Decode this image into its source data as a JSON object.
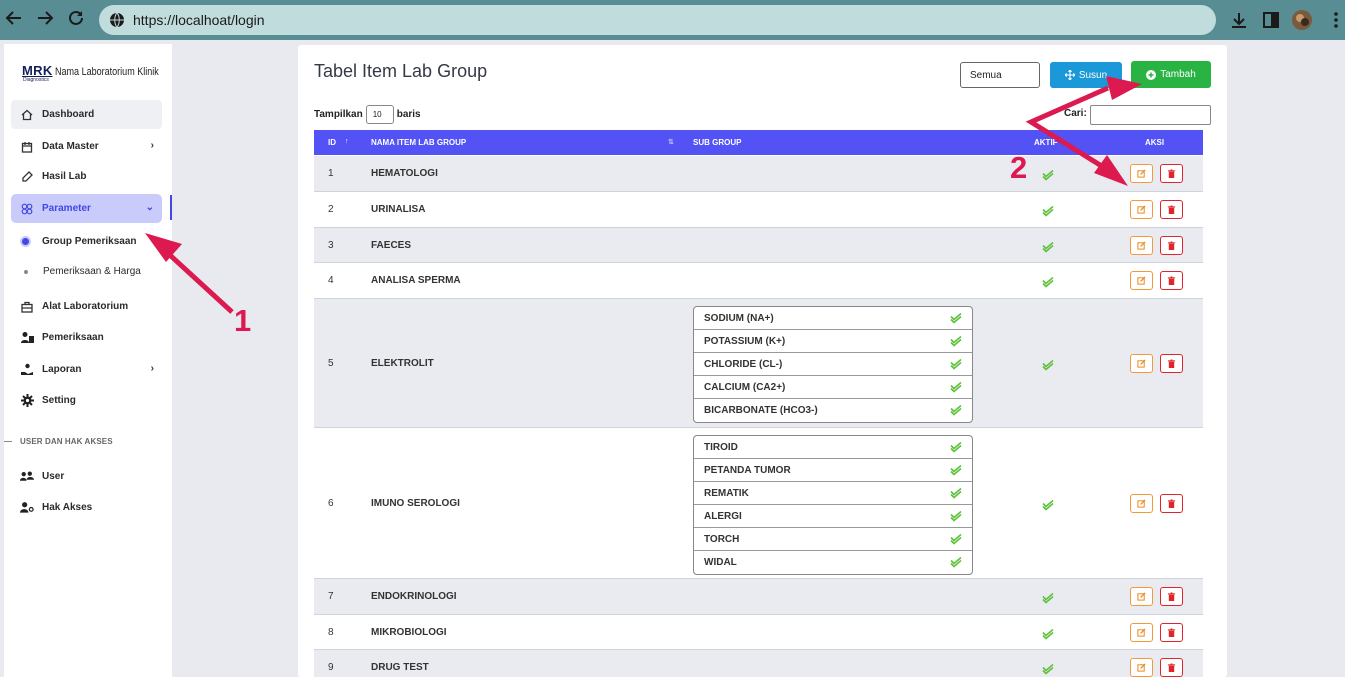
{
  "browser": {
    "url": "https://localhoat/login",
    "back_icon": "arrow-left-icon",
    "forward_icon": "arrow-right-icon",
    "reload_icon": "reload-icon"
  },
  "brand": {
    "logo": "MRK",
    "logo_sub": "Diagnostics",
    "name": "Nama Laboratorium Klinik"
  },
  "sidebar": {
    "items": [
      {
        "label": "Dashboard",
        "icon": "home-icon"
      },
      {
        "label": "Data Master",
        "icon": "calendar-icon"
      },
      {
        "label": "Hasil Lab",
        "icon": "flask-icon"
      },
      {
        "label": "Parameter",
        "icon": "grid-icon"
      },
      {
        "label": "Alat Laboratorium",
        "icon": "briefcase-icon"
      },
      {
        "label": "Pemeriksaan",
        "icon": "user-lab-icon"
      },
      {
        "label": "Laporan",
        "icon": "hand-icon"
      },
      {
        "label": "Setting",
        "icon": "gear-icon"
      },
      {
        "label": "User",
        "icon": "users-icon"
      },
      {
        "label": "Hak Akses",
        "icon": "user-key-icon"
      }
    ],
    "sub_items": [
      {
        "label": "Group Pemeriksaan"
      },
      {
        "label": "Pemeriksaan & Harga"
      }
    ],
    "section_label": "USER DAN HAK AKSES"
  },
  "page": {
    "title": "Tabel Item Lab Group",
    "filter_value": "Semua",
    "susun_label": "Susun",
    "tambah_label": "Tambah",
    "tampilkan_label": "Tampilkan",
    "page_length": "10",
    "baris_label": "baris",
    "cari_label": "Cari:"
  },
  "table": {
    "headers": {
      "id": "ID",
      "name": "NAMA ITEM LAB GROUP",
      "sub": "SUB GROUP",
      "aktif": "AKTIF",
      "aksi": "AKSI"
    },
    "rows": [
      {
        "id": "1",
        "name": "HEMATOLOGI"
      },
      {
        "id": "2",
        "name": "URINALISA"
      },
      {
        "id": "3",
        "name": "FAECES"
      },
      {
        "id": "4",
        "name": "ANALISA SPERMA"
      },
      {
        "id": "5",
        "name": "ELEKTROLIT",
        "subs": [
          "SODIUM (NA+)",
          "POTASSIUM (K+)",
          "CHLORIDE (CL-)",
          "CALCIUM (CA2+)",
          "BICARBONATE (HCO3-)"
        ]
      },
      {
        "id": "6",
        "name": "IMUNO SEROLOGI",
        "subs": [
          "TIROID",
          "PETANDA TUMOR",
          "REMATIK",
          "ALERGI",
          "TORCH",
          "WIDAL"
        ]
      },
      {
        "id": "7",
        "name": "ENDOKRINOLOGI"
      },
      {
        "id": "8",
        "name": "MIKROBIOLOGI"
      },
      {
        "id": "9",
        "name": "DRUG TEST"
      }
    ]
  },
  "annotations": {
    "one": "1",
    "two": "2"
  },
  "colors": {
    "accent": "#5252f5",
    "annotation": "#dc1a4f",
    "success": "#29b343",
    "info": "#1b98d8"
  }
}
